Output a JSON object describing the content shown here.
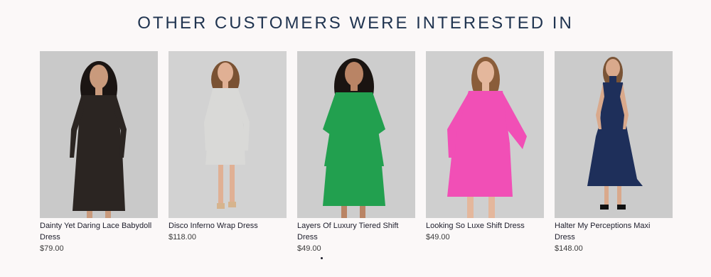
{
  "section": {
    "title": "OTHER CUSTOMERS WERE INTERESTED IN"
  },
  "products": [
    {
      "name": "Dainty Yet Daring Lace Babydoll Dress",
      "price": "$79.00",
      "photo_bg": "#c9c9c9",
      "dress_color": "#2b2522",
      "skin": "#c99a7c",
      "hair": "#1b1513"
    },
    {
      "name": "Disco Inferno Wrap Dress",
      "price": "$118.00",
      "photo_bg": "#d2d2d2",
      "dress_color": "#d9d9d7",
      "skin": "#e0b094",
      "hair": "#7a5233"
    },
    {
      "name": "Layers Of Luxury Tiered Shift Dress",
      "price": "$49.00",
      "photo_bg": "#cdcdcd",
      "dress_color": "#22a04f",
      "skin": "#b98465",
      "hair": "#1a1411"
    },
    {
      "name": "Looking So Luxe Shift Dress",
      "price": "$49.00",
      "photo_bg": "#cfcfcf",
      "dress_color": "#f14fb6",
      "skin": "#e4b79c",
      "hair": "#8a5d3a"
    },
    {
      "name": "Halter My Perceptions Maxi Dress",
      "price": "$148.00",
      "photo_bg": "#cbcbcb",
      "dress_color": "#1e2f5a",
      "skin": "#d9a98c",
      "hair": "#7a5436"
    }
  ],
  "carousel": {
    "dot_count": 1
  }
}
